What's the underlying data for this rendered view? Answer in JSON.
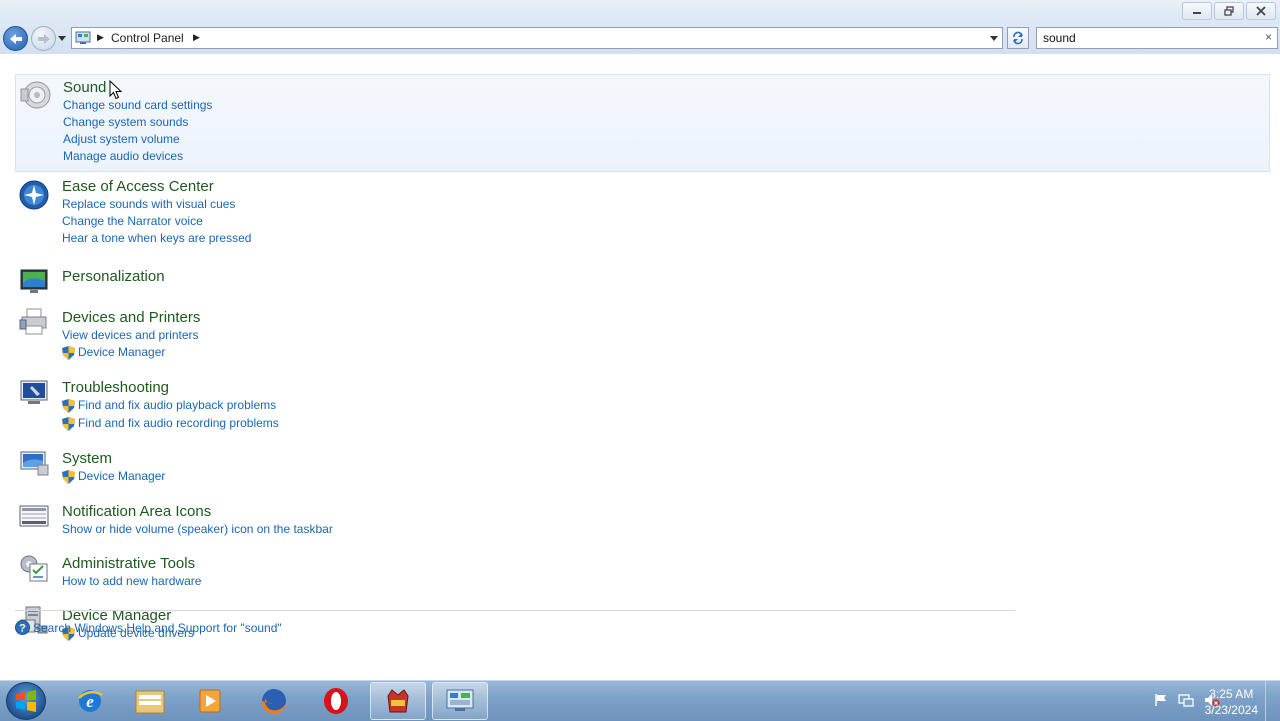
{
  "window": {
    "minimize": "minimize-icon",
    "maximize": "restore-icon",
    "close": "close-icon"
  },
  "nav": {
    "back": "back-arrow-icon",
    "forward": "forward-arrow-icon",
    "address_crumb": "Control Panel",
    "search_value": "sound",
    "search_clear": "×"
  },
  "results": [
    {
      "title": "Sound",
      "icon": "speaker-icon",
      "links": [
        {
          "label": "Change sound card settings",
          "shield": false
        },
        {
          "label": "Change system sounds",
          "shield": false
        },
        {
          "label": "Adjust system volume",
          "shield": false
        },
        {
          "label": "Manage audio devices",
          "shield": false
        }
      ]
    },
    {
      "title": "Ease of Access Center",
      "icon": "ease-of-access-icon",
      "links": [
        {
          "label": "Replace sounds with visual cues",
          "shield": false
        },
        {
          "label": "Change the Narrator voice",
          "shield": false
        },
        {
          "label": "Hear a tone when keys are pressed",
          "shield": false
        }
      ]
    },
    {
      "title": "Personalization",
      "icon": "personalization-icon",
      "links": []
    },
    {
      "title": "Devices and Printers",
      "icon": "printer-icon",
      "links": [
        {
          "label": "View devices and printers",
          "shield": false
        },
        {
          "label": "Device Manager",
          "shield": true
        }
      ]
    },
    {
      "title": "Troubleshooting",
      "icon": "troubleshooting-icon",
      "links": [
        {
          "label": "Find and fix audio playback problems",
          "shield": true
        },
        {
          "label": "Find and fix audio recording problems",
          "shield": true
        }
      ]
    },
    {
      "title": "System",
      "icon": "system-icon",
      "links": [
        {
          "label": "Device Manager",
          "shield": true
        }
      ]
    },
    {
      "title": "Notification Area Icons",
      "icon": "notification-area-icon",
      "links": [
        {
          "label": "Show or hide volume (speaker) icon on the taskbar",
          "shield": false
        }
      ]
    },
    {
      "title": "Administrative Tools",
      "icon": "admin-tools-icon",
      "links": [
        {
          "label": "How to add new hardware",
          "shield": false
        }
      ]
    },
    {
      "title": "Device Manager",
      "icon": "device-manager-icon",
      "links": [
        {
          "label": "Update device drivers",
          "shield": true
        }
      ]
    }
  ],
  "help_link": "Search Windows Help and Support for \"sound\"",
  "taskbar": {
    "items": [
      "internet-explorer-icon",
      "file-explorer-icon",
      "media-player-icon",
      "firefox-icon",
      "opera-icon",
      "game-icon",
      "control-panel-icon"
    ],
    "time": "3:25 AM",
    "date": "3/23/2024"
  },
  "colors": {
    "title_green": "#1e5a1e",
    "link_blue": "#1a66b4",
    "highlight_bg": "#ecf3fb"
  }
}
